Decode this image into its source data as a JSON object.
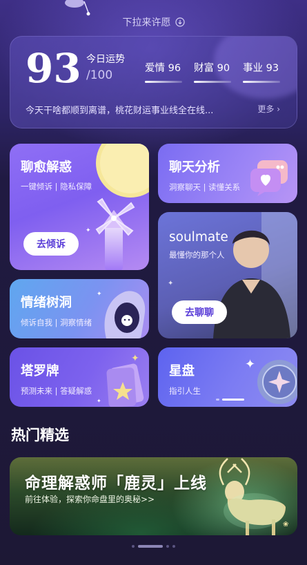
{
  "top": {
    "pull_hint": "下拉来许愿"
  },
  "fortune": {
    "score": "93",
    "label": "今日运势",
    "max": "/100",
    "metrics": [
      {
        "name": "爱情",
        "value": "96"
      },
      {
        "name": "财富",
        "value": "90"
      },
      {
        "name": "事业",
        "value": "93"
      }
    ],
    "description": "今天干啥都顺到离谱，桃花财运事业线全在线...",
    "more": "更多"
  },
  "cards": {
    "healing": {
      "title": "聊愈解惑",
      "subtitle": "一键倾诉 | 隐私保障",
      "button": "去倾诉"
    },
    "chat_analysis": {
      "title": "聊天分析",
      "subtitle": "洞察聊天 | 读懂关系"
    },
    "soulmate": {
      "title": "soulmate",
      "subtitle": "最懂你的那个人",
      "button": "去聊聊"
    },
    "tree_hole": {
      "title": "情绪树洞",
      "subtitle": "倾诉自我 | 洞察情绪"
    },
    "tarot": {
      "title": "塔罗牌",
      "subtitle": "预测未来 | 答疑解惑"
    },
    "astro": {
      "title": "星盘",
      "subtitle": "指引人生"
    }
  },
  "section": {
    "title": "热门精选"
  },
  "banner": {
    "title": "命理解惑师「鹿灵」上线",
    "subtitle": "前往体验，探索你命盘里的奥秘>>"
  },
  "colors": {
    "accent": "#5b3fd8",
    "background": "#1f1838"
  }
}
